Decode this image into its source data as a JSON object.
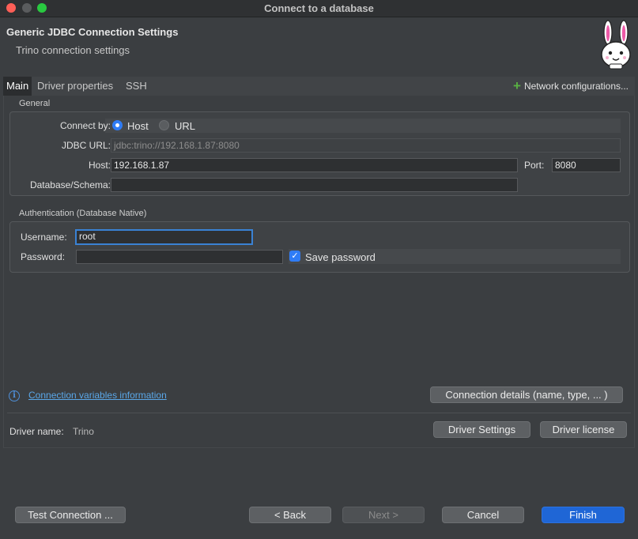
{
  "window": {
    "title": "Connect to a database"
  },
  "header": {
    "title": "Generic JDBC Connection Settings",
    "subtitle": "Trino connection settings",
    "mascot_icon": "rabbit-mascot-icon"
  },
  "tabs": [
    {
      "label": "Main",
      "active": true
    },
    {
      "label": "Driver properties",
      "active": false
    },
    {
      "label": "SSH",
      "active": false
    }
  ],
  "network_configurations": {
    "label": "Network configurations...",
    "icon": "plus-icon"
  },
  "general": {
    "group_label": "General",
    "connect_by_label": "Connect by:",
    "connect_by_options": [
      {
        "label": "Host",
        "selected": true
      },
      {
        "label": "URL",
        "selected": false
      }
    ],
    "jdbc_url_label": "JDBC URL:",
    "jdbc_url_value": "jdbc:trino://192.168.1.87:8080",
    "host_label": "Host:",
    "host_value": "192.168.1.87",
    "port_label": "Port:",
    "port_value": "8080",
    "database_label": "Database/Schema:",
    "database_value": ""
  },
  "authentication": {
    "group_label": "Authentication (Database Native)",
    "username_label": "Username:",
    "username_value": "root",
    "password_label": "Password:",
    "password_value": "",
    "save_password_label": "Save password",
    "save_password_checked": true
  },
  "footer_panel": {
    "connection_variables_link": "Connection variables information",
    "connection_details_button": "Connection details (name, type, ... )",
    "driver_name_label": "Driver name:",
    "driver_name_value": "Trino",
    "driver_settings_button": "Driver Settings",
    "driver_license_button": "Driver license"
  },
  "buttons": {
    "test_connection": "Test Connection ...",
    "back": "< Back",
    "next": "Next >",
    "cancel": "Cancel",
    "finish": "Finish"
  },
  "colors": {
    "accent": "#2f7cf6",
    "primary_button": "#1f66d6",
    "link": "#5aa7e8",
    "plus": "#59b043"
  }
}
